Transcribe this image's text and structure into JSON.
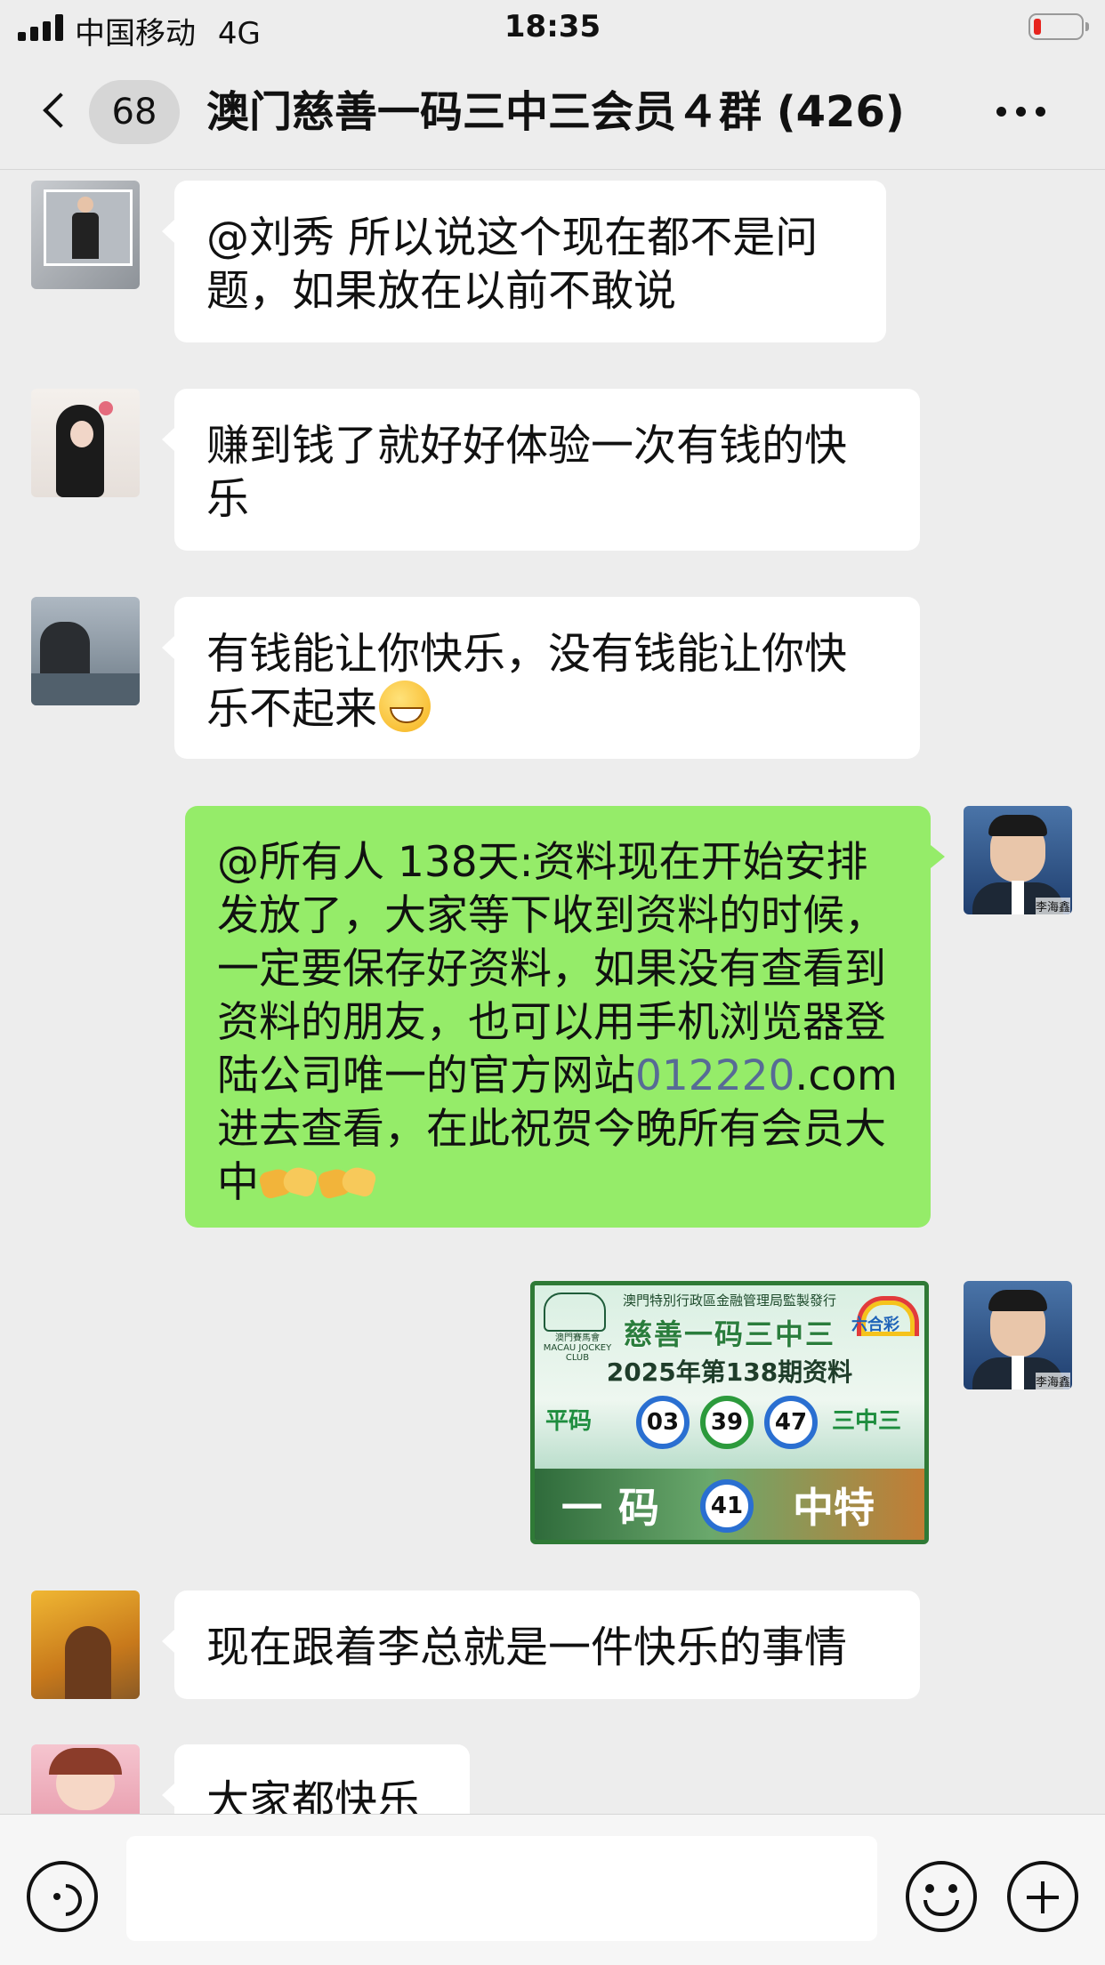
{
  "status_bar": {
    "carrier": "中国移动",
    "network": "4G",
    "time": "18:35",
    "battery_color": "#e7241e"
  },
  "nav": {
    "unread_count": "68",
    "title": "澳门慈善一码三中三会员４群 (426)",
    "back_icon": "chevron-left-icon",
    "more_icon": "more-horizontal-icon"
  },
  "messages": [
    {
      "side": "in",
      "text": "@刘秀 所以说这个现在都不是问题，如果放在以前不敢说"
    },
    {
      "side": "in",
      "text": "赚到钱了就好好体验一次有钱的快乐"
    },
    {
      "side": "in",
      "text": "有钱能让你快乐，没有钱能让你快乐不起来",
      "emoji": "grinning-face-icon"
    },
    {
      "side": "out",
      "text_before_link": "@所有人 138天:资料现在开始安排发放了，大家等下收到资料的时候，一定要保存好资料，如果没有查看到资料的朋友，也可以用手机浏览器登陆公司唯一的官方网站",
      "link": "012220",
      "text_after_link": ".com进去查看，在此祝贺今晚所有会员大中",
      "emoji": "handshake-icon",
      "sender_avatar_label": "李海鑫"
    },
    {
      "side": "in",
      "text": "现在跟着李总就是一件快乐的事情"
    },
    {
      "side": "in",
      "text": "大家都快乐"
    }
  ],
  "image_card": {
    "top_line": "澳門特別行政區金融管理局監製發行",
    "brand": "澳門賽馬會 MACAU JOCKEY CLUB",
    "logo_tag": "六合彩",
    "title": "慈善一码三中三",
    "subtitle": "2025年第138期资料",
    "left_label": "平码",
    "right_label": "三中三",
    "balls": [
      "03",
      "39",
      "47"
    ],
    "bottom_left": "一码",
    "special_ball": "41",
    "bottom_right": "中特"
  },
  "input_bar": {
    "voice_icon": "voice-icon",
    "emoji_icon": "smile-icon",
    "plus_icon": "plus-icon",
    "placeholder": ""
  }
}
